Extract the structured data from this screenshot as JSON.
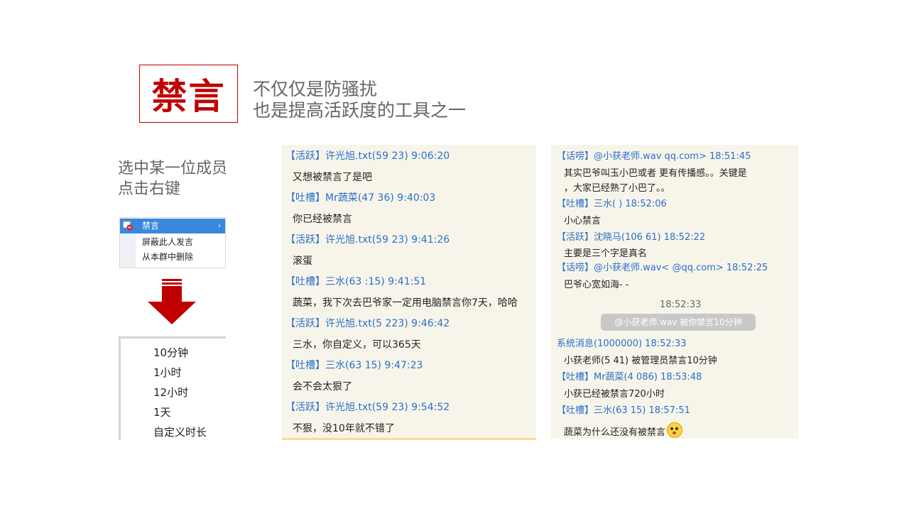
{
  "title": "禁言",
  "subtitle": [
    "不仅仅是防骚扰",
    "也是提高活跃度的工具之一"
  ],
  "instruction": [
    "选中某一位成员",
    "点击右键"
  ],
  "context_menu": {
    "items": [
      "禁言",
      "屏蔽此人发言",
      "从本群中删除"
    ],
    "submenu_arrow": "›"
  },
  "duration_menu": [
    "10分钟",
    "1小时",
    "12小时",
    "1天",
    "自定义时长"
  ],
  "chat_left": [
    {
      "type": "hdr",
      "text": "【活跃】许光旭.txt(59          23) 9:06:20"
    },
    {
      "type": "msg",
      "text": "又想被禁言了是吧"
    },
    {
      "type": "hdr",
      "text": "【吐槽】Mr蔬菜(47           36) 9:40:03"
    },
    {
      "type": "msg",
      "text": "你已经被禁言"
    },
    {
      "type": "hdr",
      "text": "【活跃】许光旭.txt(59          23) 9:41:26"
    },
    {
      "type": "msg",
      "text": "滚蛋"
    },
    {
      "type": "hdr",
      "text": "【吐槽】三水(63           :15) 9:41:51"
    },
    {
      "type": "msg",
      "text": "蔬菜，我下次去巴爷家一定用电脑禁言你7天，哈哈"
    },
    {
      "type": "hdr",
      "text": "【活跃】许光旭.txt(5       223) 9:46:42"
    },
    {
      "type": "msg",
      "text": "三水，你自定义，可以365天"
    },
    {
      "type": "hdr",
      "text": "【吐槽】三水(63           15) 9:47:23"
    },
    {
      "type": "msg",
      "text": "会不会太狠了"
    },
    {
      "type": "hdr",
      "text": "【活跃】许光旭.txt(59       23) 9:54:52"
    },
    {
      "type": "msg",
      "text": "不狠，没10年就不错了"
    }
  ],
  "chat_right": [
    {
      "type": "hdr",
      "text": "【话唠】@小获老师.wav              qq.com> 18:51:45"
    },
    {
      "type": "msg",
      "text": "其实巴爷叫玉小巴或者        更有传播感。。关键是"
    },
    {
      "type": "msg",
      "text": "，大家已经熟了小巴了。。"
    },
    {
      "type": "hdr",
      "text": "【吐槽】三水(             ) 18:52:06"
    },
    {
      "type": "msg",
      "text": "小心禁言"
    },
    {
      "type": "hdr",
      "text": "【活跃】沈晓马(106          61) 18:52:22"
    },
    {
      "type": "msg",
      "text": "主要是三个字是真名"
    },
    {
      "type": "hdr",
      "text": "【话唠】@小获老师.wav<           @qq.com> 18:52:25"
    },
    {
      "type": "msg",
      "text": "巴爷心宽如海- -"
    },
    {
      "type": "time",
      "text": "18:52:33"
    },
    {
      "type": "pill",
      "text": "@小获老师.wav 被你禁言10分钟"
    },
    {
      "type": "hdr",
      "text": "系统消息(1000000) 18:52:33"
    },
    {
      "type": "msg",
      "text": "小获老师(5           41) 被管理员禁言10分钟"
    },
    {
      "type": "hdr",
      "text": "【吐槽】Mr蔬菜(4           086) 18:53:48"
    },
    {
      "type": "msg",
      "text": "小获已经被禁言720小时"
    },
    {
      "type": "hdr",
      "text": "【吐槽】三水(63           15) 18:57:51"
    },
    {
      "type": "msg",
      "text": "蔬菜为什么还没有被禁言",
      "emoji": "blush-emoji"
    }
  ],
  "colors": {
    "accent": "#c00000",
    "link": "#2a6fcb",
    "menu_highlight": "#3a88dd",
    "chat_bg": "#f7f5ea"
  }
}
